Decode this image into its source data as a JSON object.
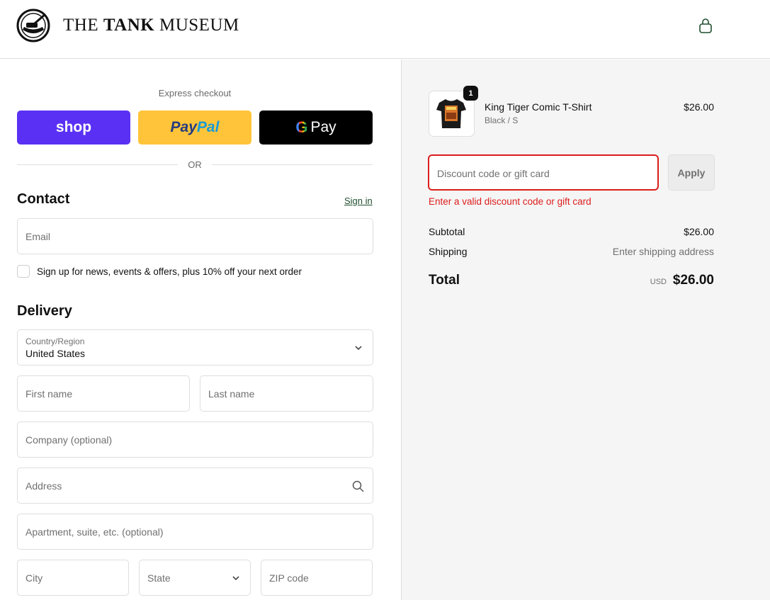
{
  "header": {
    "brand_prefix": "THE",
    "brand_bold": "TANK",
    "brand_suffix": "MUSEUM",
    "bag_icon": "shopping-bag-icon"
  },
  "express": {
    "label": "Express checkout",
    "shop_label": "shop",
    "paypal_part1": "Pay",
    "paypal_part2": "Pal",
    "gpay_g": "G",
    "gpay_label": "Pay",
    "or_label": "OR"
  },
  "contact": {
    "title": "Contact",
    "signin": "Sign in",
    "email_placeholder": "Email",
    "newsletter_label": "Sign up for news, events & offers, plus 10% off your next order"
  },
  "delivery": {
    "title": "Delivery",
    "country_label": "Country/Region",
    "country_value": "United States",
    "first_name": "First name",
    "last_name": "Last name",
    "company": "Company (optional)",
    "address": "Address",
    "apartment": "Apartment, suite, etc. (optional)",
    "city": "City",
    "state": "State",
    "zip": "ZIP code"
  },
  "cart": {
    "item": {
      "quantity": "1",
      "name": "King Tiger Comic T-Shirt",
      "variant": "Black / S",
      "price": "$26.00"
    },
    "discount_placeholder": "Discount code or gift card",
    "apply_label": "Apply",
    "discount_error": "Enter a valid discount code or gift card",
    "subtotal_label": "Subtotal",
    "subtotal_value": "$26.00",
    "shipping_label": "Shipping",
    "shipping_value": "Enter shipping address",
    "total_label": "Total",
    "total_currency": "USD",
    "total_value": "$26.00"
  },
  "colors": {
    "shop_pay": "#5a31f4",
    "paypal": "#ffc439",
    "gpay": "#000000",
    "error": "#dd1d1d"
  }
}
